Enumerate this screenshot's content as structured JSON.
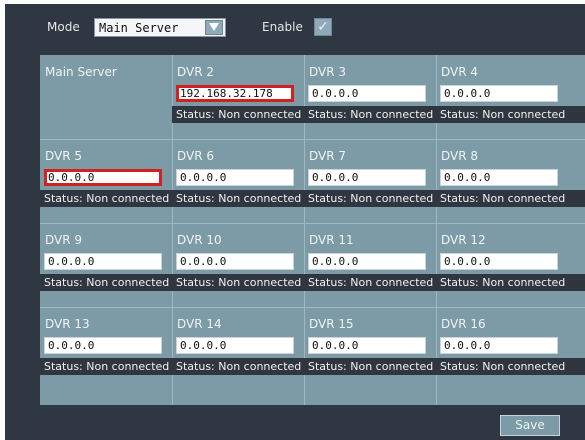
{
  "header": {
    "mode_label": "Mode",
    "mode_value": "Main Server",
    "enable_label": "Enable",
    "enable_checked": true
  },
  "grid": {
    "cells": [
      {
        "name": "Main Server",
        "ip": "",
        "status": ""
      },
      {
        "name": "DVR 2",
        "ip": "192.168.32.178",
        "status": "Status: Non connected"
      },
      {
        "name": "DVR 3",
        "ip": "0.0.0.0",
        "status": "Status: Non connected"
      },
      {
        "name": "DVR 4",
        "ip": "0.0.0.0",
        "status": "Status: Non connected"
      },
      {
        "name": "DVR 5",
        "ip": "0.0.0.0",
        "status": "Status: Non connected"
      },
      {
        "name": "DVR 6",
        "ip": "0.0.0.0",
        "status": "Status: Non connected"
      },
      {
        "name": "DVR 7",
        "ip": "0.0.0.0",
        "status": "Status: Non connected"
      },
      {
        "name": "DVR 8",
        "ip": "0.0.0.0",
        "status": "Status: Non connected"
      },
      {
        "name": "DVR 9",
        "ip": "0.0.0.0",
        "status": "Status: Non connected"
      },
      {
        "name": "DVR 10",
        "ip": "0.0.0.0",
        "status": "Status: Non connected"
      },
      {
        "name": "DVR 11",
        "ip": "0.0.0.0",
        "status": "Status: Non connected"
      },
      {
        "name": "DVR 12",
        "ip": "0.0.0.0",
        "status": "Status: Non connected"
      },
      {
        "name": "DVR 13",
        "ip": "0.0.0.0",
        "status": "Status: Non connected"
      },
      {
        "name": "DVR 14",
        "ip": "0.0.0.0",
        "status": "Status: Non connected"
      },
      {
        "name": "DVR 15",
        "ip": "0.0.0.0",
        "status": "Status: Non connected"
      },
      {
        "name": "DVR 16",
        "ip": "0.0.0.0",
        "status": "Status: Non connected"
      }
    ]
  },
  "footer": {
    "save_label": "Save"
  },
  "colors": {
    "panel_bg": "#2f3742",
    "grid_bg": "#7c9ba6",
    "highlight": "#d42020"
  }
}
